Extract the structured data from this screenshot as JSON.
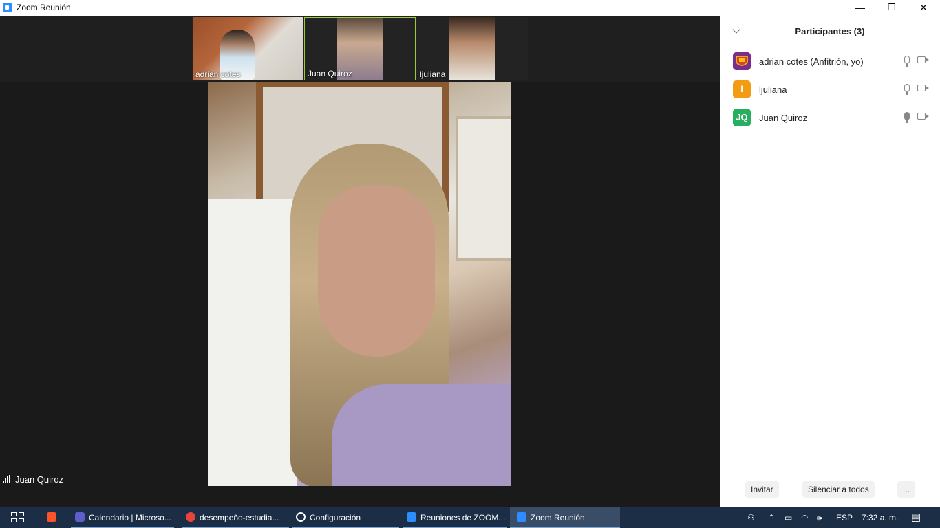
{
  "window": {
    "title": "Zoom Reunión",
    "minimize_glyph": "—",
    "restore_glyph": "❐",
    "close_glyph": "✕"
  },
  "video": {
    "thumbnails": [
      {
        "name": "adrian cotes"
      },
      {
        "name": "Juan Quiroz"
      },
      {
        "name": "ljuliana"
      }
    ],
    "active_speaker": "Juan Quiroz",
    "active_thumbnail_border": "#9acd32"
  },
  "participants": {
    "title": "Participantes (3)",
    "list": [
      {
        "name": "adrian cotes (Anfitrión, yo)",
        "avatar_text": "",
        "avatar_color": "#c0392b",
        "mic_icon": "mic-icon",
        "cam_icon": "video-off-icon"
      },
      {
        "name": "ljuliana",
        "avatar_text": "l",
        "avatar_color": "#f39c12",
        "mic_icon": "mic-icon",
        "cam_icon": "video-off-icon"
      },
      {
        "name": "Juan Quiroz",
        "avatar_text": "JQ",
        "avatar_color": "#27ae60",
        "mic_icon": "mic-active-icon",
        "cam_icon": "video-off-icon"
      }
    ],
    "buttons": {
      "invite": "Invitar",
      "mute_all": "Silenciar a todos",
      "more": "..."
    }
  },
  "taskbar": {
    "items": [
      {
        "label": "Calendario | Microso...",
        "icon": "teams-icon",
        "color": "#5b5fc7"
      },
      {
        "label": "desempeño-estudia...",
        "icon": "chrome-icon",
        "color": "#e9443a"
      },
      {
        "label": "Configuración",
        "icon": "settings-icon",
        "color": "#ffffff"
      },
      {
        "label": "Reuniones de ZOOM...",
        "icon": "zoom-icon",
        "color": "#2d8cff"
      },
      {
        "label": "Zoom Reunión",
        "icon": "zoom-icon",
        "color": "#2d8cff"
      }
    ],
    "tray": {
      "language": "ESP",
      "time": "7:32 a. m."
    }
  }
}
